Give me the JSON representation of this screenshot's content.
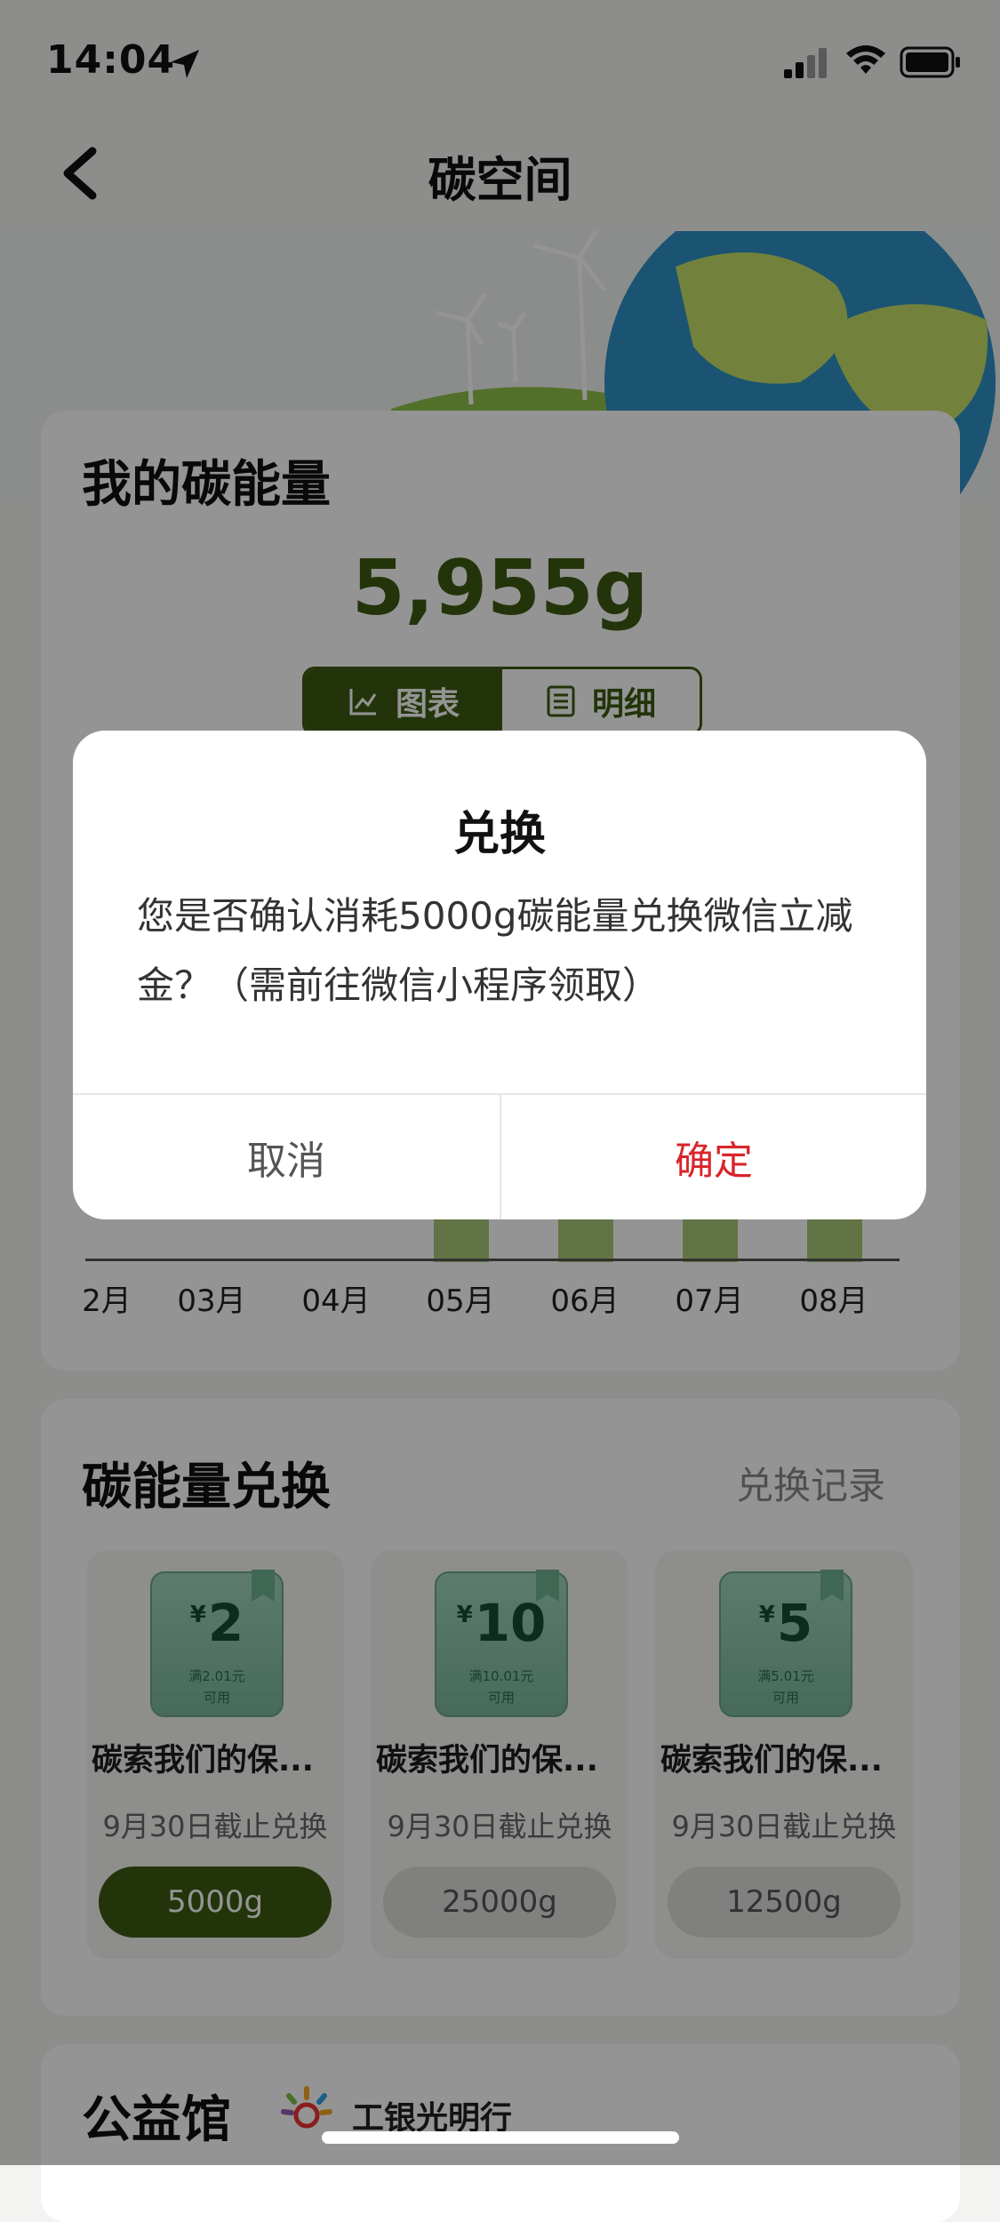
{
  "status_bar": {
    "time": "14:04"
  },
  "header": {
    "title": "碳空间"
  },
  "energy_card": {
    "heading": "我的碳能量",
    "value": "5,955g",
    "toggle": {
      "chart_label": "图表",
      "detail_label": "明细"
    },
    "months": [
      "2月",
      "03月",
      "04月",
      "05月",
      "06月",
      "07月",
      "08月"
    ]
  },
  "exchange": {
    "heading": "碳能量兑换",
    "records_link": "兑换记录",
    "coupons": [
      {
        "currency": "¥",
        "amount": "2",
        "condition": "满2.01元",
        "usable": "可用",
        "name": "碳索我们的保...",
        "deadline": "9月30日截止兑换",
        "cost": "5000g",
        "active": true
      },
      {
        "currency": "¥",
        "amount": "10",
        "condition": "满10.01元",
        "usable": "可用",
        "name": "碳索我们的保...",
        "deadline": "9月30日截止兑换",
        "cost": "25000g",
        "active": false
      },
      {
        "currency": "¥",
        "amount": "5",
        "condition": "满5.01元",
        "usable": "可用",
        "name": "碳索我们的保...",
        "deadline": "9月30日截止兑换",
        "cost": "12500g",
        "active": false
      }
    ]
  },
  "charity": {
    "heading": "公益馆",
    "partner": "工银光明行"
  },
  "dialog": {
    "title": "兑换",
    "message": "您是否确认消耗5000g碳能量兑换微信立减金？（需前往微信小程序领取）",
    "cancel_label": "取消",
    "confirm_label": "确定"
  },
  "colors": {
    "primary_green": "#3d5a12",
    "confirm_red": "#d8262b"
  }
}
